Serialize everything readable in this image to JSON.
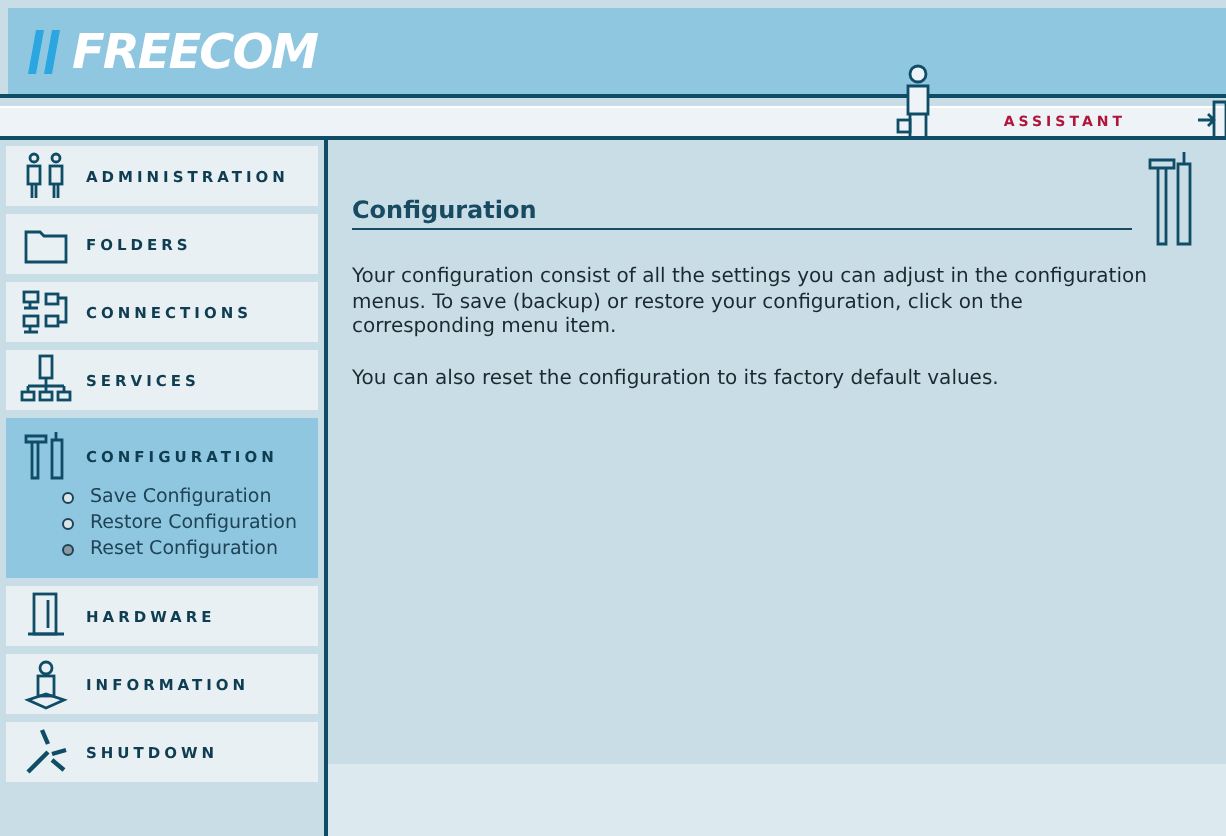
{
  "header": {
    "logo": "FREECOM",
    "assistant": "ASSISTANT"
  },
  "sidebar": {
    "items": [
      {
        "label": "ADMINISTRATION",
        "kind": "people",
        "selected": false
      },
      {
        "label": "FOLDERS",
        "kind": "folder",
        "selected": false
      },
      {
        "label": "CONNECTIONS",
        "kind": "network",
        "selected": false
      },
      {
        "label": "SERVICES",
        "kind": "server",
        "selected": false
      },
      {
        "label": "CONFIGURATION",
        "kind": "tools",
        "selected": true,
        "children": [
          {
            "label": "Save Configuration",
            "selected": false
          },
          {
            "label": "Restore Configuration",
            "selected": false
          },
          {
            "label": "Reset Configuration",
            "selected": true
          }
        ]
      },
      {
        "label": "HARDWARE",
        "kind": "hardware",
        "selected": false
      },
      {
        "label": "INFORMATION",
        "kind": "info",
        "selected": false
      },
      {
        "label": "SHUTDOWN",
        "kind": "shutdown",
        "selected": false
      }
    ]
  },
  "content": {
    "title": "Configuration",
    "paragraphs": [
      "Your configuration consist of all the settings you can adjust in the configuration menus. To save (backup) or restore your configuration, click on the corresponding menu item.",
      "You can also reset the configuration to its factory default values."
    ]
  }
}
